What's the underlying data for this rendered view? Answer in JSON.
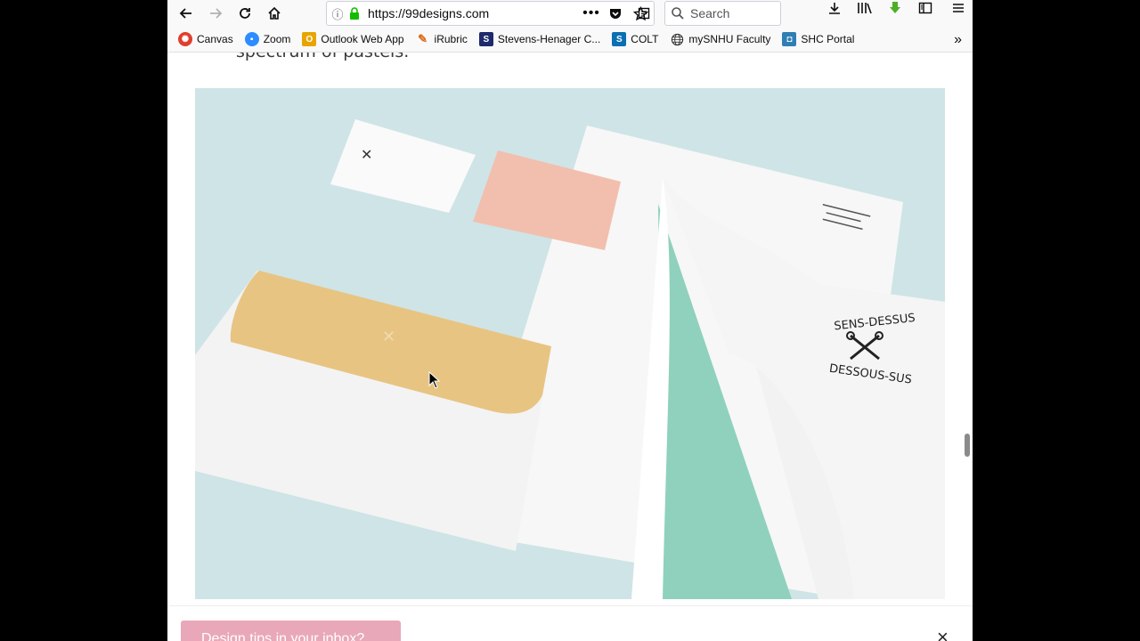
{
  "browser": {
    "url": "https://99designs.com",
    "url_host": "99designs.com",
    "url_scheme": "https://",
    "search_placeholder": "Search"
  },
  "bookmarks": [
    {
      "label": "Canvas",
      "icon": "canvas-icon",
      "color": "#e03e2d"
    },
    {
      "label": "Zoom",
      "icon": "zoom-icon",
      "color": "#2d8cff"
    },
    {
      "label": "Outlook Web App",
      "icon": "outlook-icon",
      "color": "#e8a500"
    },
    {
      "label": "iRubric",
      "icon": "irubric-icon",
      "color": "#e06a1a"
    },
    {
      "label": "Stevens-Henager C...",
      "icon": "stevens-henager-icon",
      "color": "#1d2a6b"
    },
    {
      "label": "COLT",
      "icon": "sharepoint-icon",
      "color": "#0b6fb3"
    },
    {
      "label": "mySNHU Faculty",
      "icon": "globe-icon",
      "color": "#333333"
    },
    {
      "label": "SHC Portal",
      "icon": "shc-portal-icon",
      "color": "#2f7fb5"
    }
  ],
  "content": {
    "caption": "spectrum of pastels.",
    "hero_logo_text": "SENS DESSUS DESSOUS",
    "banner_button": "Design tips in your inbox?",
    "banner_close": "×"
  },
  "colors": {
    "hero_bg": "#cfe4e6",
    "envelope_flap": "#e8c482",
    "card_pink": "#f2bfae",
    "mint": "#8fd1bd",
    "banner_button": "#e9a8b9"
  }
}
